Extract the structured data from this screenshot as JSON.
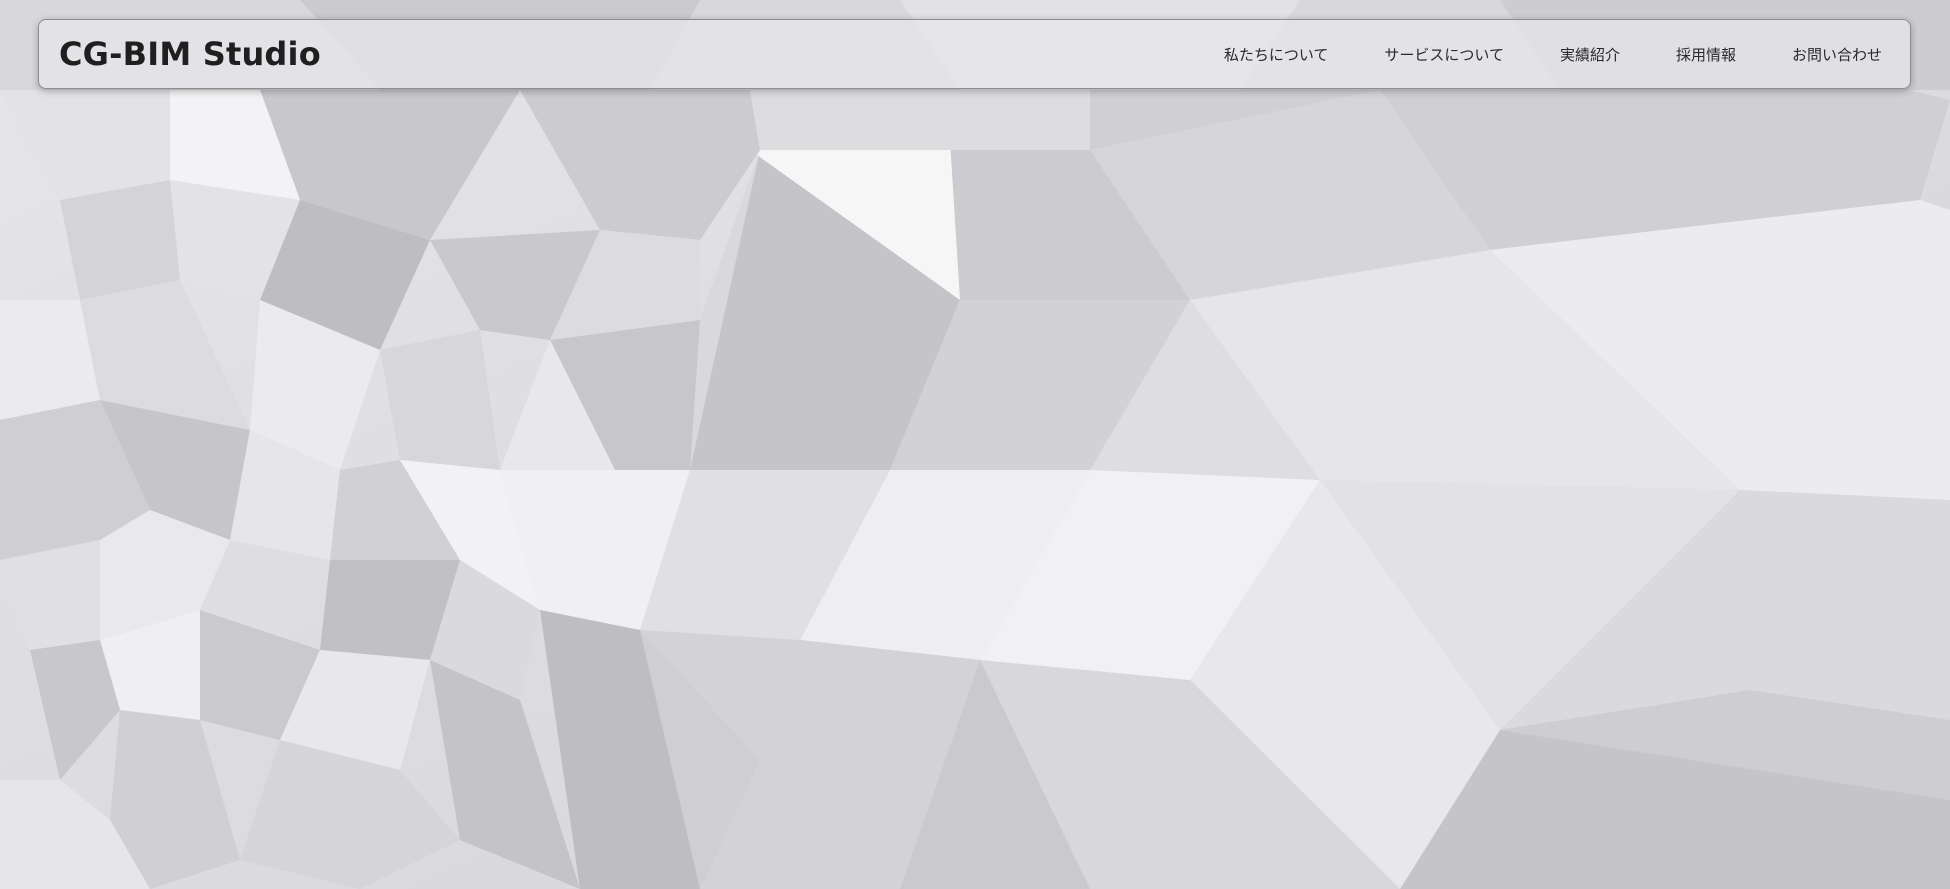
{
  "site": {
    "brand": "CG-BIM Studio"
  },
  "nav": {
    "items": [
      {
        "label": "私たちについて"
      },
      {
        "label": "サービスについて"
      },
      {
        "label": "実績紹介"
      },
      {
        "label": "採用情報"
      },
      {
        "label": "お問い合わせ"
      }
    ]
  },
  "hero": {
    "background": "white-low-poly-geometric-pattern",
    "palette": [
      "#f4f4f6",
      "#e4e4e7",
      "#d2d2d6",
      "#c0c0c5",
      "#adadb2"
    ]
  }
}
